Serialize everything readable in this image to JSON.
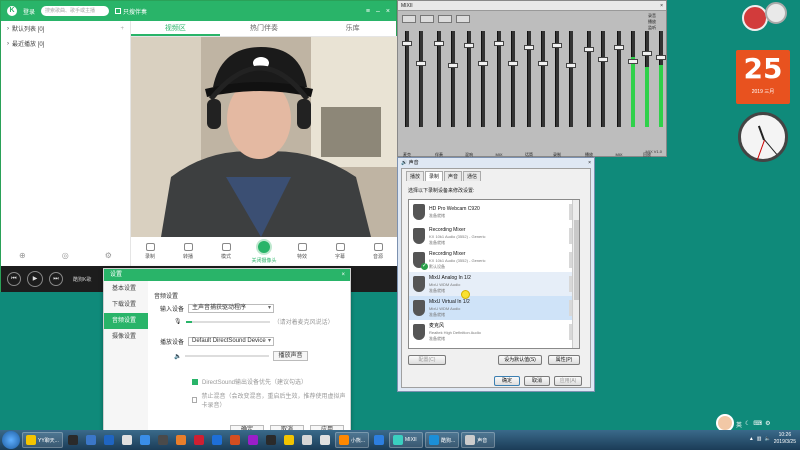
{
  "player": {
    "title": "登录",
    "search_placeholder": "搜索歌曲、歌手或主播",
    "only_companion": "只搜伴奏",
    "left_items": [
      {
        "label": "默认列表 [0]"
      },
      {
        "label": "最近播放 [0]"
      }
    ],
    "tabs": [
      "视频区",
      "热门伴奏",
      "乐库"
    ],
    "tools": [
      "录制",
      "转播",
      "模式",
      "关闭摄像头",
      "特效",
      "字幕",
      "音源"
    ],
    "now_playing": "酷狗K歌"
  },
  "settings": {
    "title": "设置",
    "nav": [
      "基本设置",
      "下载设置",
      "音频设置",
      "摄像设置"
    ],
    "section": "音频设置",
    "input_label": "输入设备",
    "input_value": "主声音捕获驱动程序",
    "mic_hint": "（请对着麦克风说话）",
    "output_label": "播放设备",
    "output_value": "Default DirectSound Device",
    "play_test": "播放声音",
    "input_level": 0.08,
    "output_level": 0.0,
    "check1": "DirectSound输出设备优先（建议勾选）",
    "check1_on": true,
    "check2": "禁止混音（会改变混音，重启后生效，推荐使用虚拟声卡录音）",
    "check2_on": false,
    "buttons": [
      "确定",
      "取消",
      "应用"
    ]
  },
  "mixer": {
    "title": "MIXII",
    "options": [
      "录音",
      "播放",
      "监听"
    ],
    "channels": [
      "麦克",
      "",
      "伴奏",
      "",
      "混响",
      "",
      "MIX",
      "",
      "话筒",
      "",
      "录制",
      "",
      "播放",
      "",
      "MIX",
      "",
      "回放",
      ""
    ],
    "version": "MIX V1.0"
  },
  "sound": {
    "title": "声音",
    "tabs": [
      "播放",
      "录制",
      "声音",
      "通信"
    ],
    "instruction": "选择以下录制设备来修改设置:",
    "devices": [
      {
        "name": "HD Pro Webcam C920",
        "desc": "",
        "status": "准备就绪"
      },
      {
        "name": "Recording Mixer",
        "desc": "KX 10k1 Audio (3552) - Generic",
        "status": "准备就绪"
      },
      {
        "name": "Recording Mixer",
        "desc": "KX 10k1 Audio (3552) - Generic",
        "status": "默认设备"
      },
      {
        "name": "MixU Analog In 1/2",
        "desc": "MixU WDM Audio",
        "status": "准备就绪"
      },
      {
        "name": "MixU Virtual In 1/2",
        "desc": "MixU WDM Audio",
        "status": "准备就绪"
      },
      {
        "name": "麦克风",
        "desc": "Realtek High Definition Audio",
        "status": "准备就绪"
      }
    ],
    "btn_configure": "配置(C)",
    "btn_default": "设为默认值(S)",
    "btn_properties": "属性(P)",
    "btn_ok": "确定",
    "btn_cancel": "取消",
    "btn_apply": "应用(A)"
  },
  "desktop": {
    "calendar_day": "25",
    "calendar_ym": "2019 三月"
  },
  "taskbar": {
    "items": [
      {
        "label": "YY聊天...",
        "color": "#f5c400"
      },
      {
        "label": "",
        "color": "#2a2a2a"
      },
      {
        "label": "",
        "color": "#3b77c9"
      },
      {
        "label": "",
        "color": "#1f65c2"
      },
      {
        "label": "",
        "color": "#e0e0e0"
      },
      {
        "label": "",
        "color": "#3a8ee8"
      },
      {
        "label": "",
        "color": "#4a4a4a"
      },
      {
        "label": "",
        "color": "#e97e2b"
      },
      {
        "label": "",
        "color": "#cf1f32"
      },
      {
        "label": "",
        "color": "#1e6fd8"
      },
      {
        "label": "",
        "color": "#d34e21"
      },
      {
        "label": "",
        "color": "#9b1ec9"
      },
      {
        "label": "",
        "color": "#2a2a2a"
      },
      {
        "label": "",
        "color": "#f2c400"
      },
      {
        "label": "",
        "color": "#d6d6d6"
      },
      {
        "label": "",
        "color": "#e0e0e0"
      },
      {
        "label": "小熊...",
        "color": "#ff8800"
      },
      {
        "label": "",
        "color": "#2d7fe0"
      },
      {
        "label": "MIXII",
        "color": "#3ad0c0"
      },
      {
        "label": "酷狗...",
        "color": "#1b8fd8"
      },
      {
        "label": "声音",
        "color": "#cccccc"
      }
    ],
    "time": "10:26",
    "date": "2019/3/25"
  }
}
